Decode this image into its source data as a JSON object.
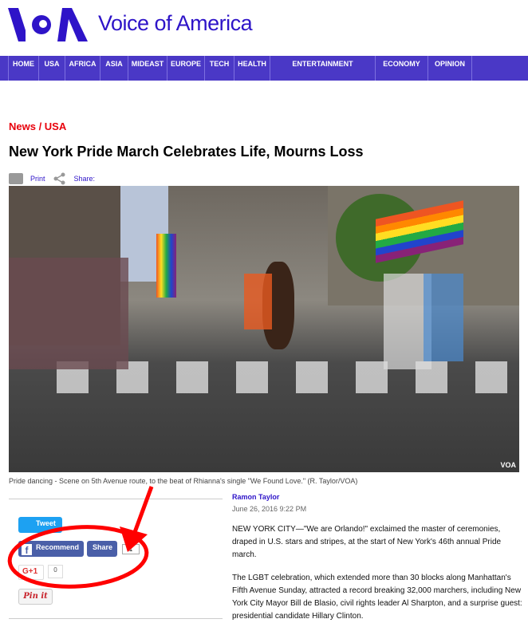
{
  "header": {
    "brand": "Voice of America",
    "logo_text": "VOA"
  },
  "nav": [
    "HOME",
    "USA",
    "AFRICA",
    "ASIA",
    "MIDEAST",
    "EUROPE",
    "TECH",
    "HEALTH",
    "ENTERTAINMENT",
    "ECONOMY",
    "OPINION"
  ],
  "article": {
    "breadcrumb": "News / USA",
    "title": "New York Pride March Celebrates Life, Mourns Loss",
    "print_label": "Print",
    "share_label": "Share:",
    "photo_watermark": "VOA",
    "caption": "Pride dancing - Scene on 5th Avenue route, to the beat of Rhianna's single \"We Found Love.\" (R. Taylor/VOA)",
    "author": "Ramon Taylor",
    "date": "June 26, 2016 9:22 PM",
    "paragraphs": [
      "NEW YORK CITY—\"We are Orlando!\" exclaimed the master of ceremonies, draped in U.S. stars and stripes, at the start of New York's 46th annual Pride march.",
      "The LGBT celebration, which extended more than 30 blocks along Manhattan's Fifth Avenue Sunday, attracted a record breaking 32,000 marchers, including New York City Mayor Bill de Blasio, civil rights leader Al Sharpton, and a surprise guest: presidential candidate Hillary Clinton."
    ]
  },
  "social": {
    "tweet": "Tweet",
    "recommend": "Recommend",
    "share": "Share",
    "share_count": "1",
    "gplus_count": "0",
    "pinit": "Pin it"
  },
  "colors": {
    "brand": "#2e14c8",
    "nav": "#4a38c6",
    "breadcrumb": "#e8000b",
    "annotation": "#ff0000"
  }
}
